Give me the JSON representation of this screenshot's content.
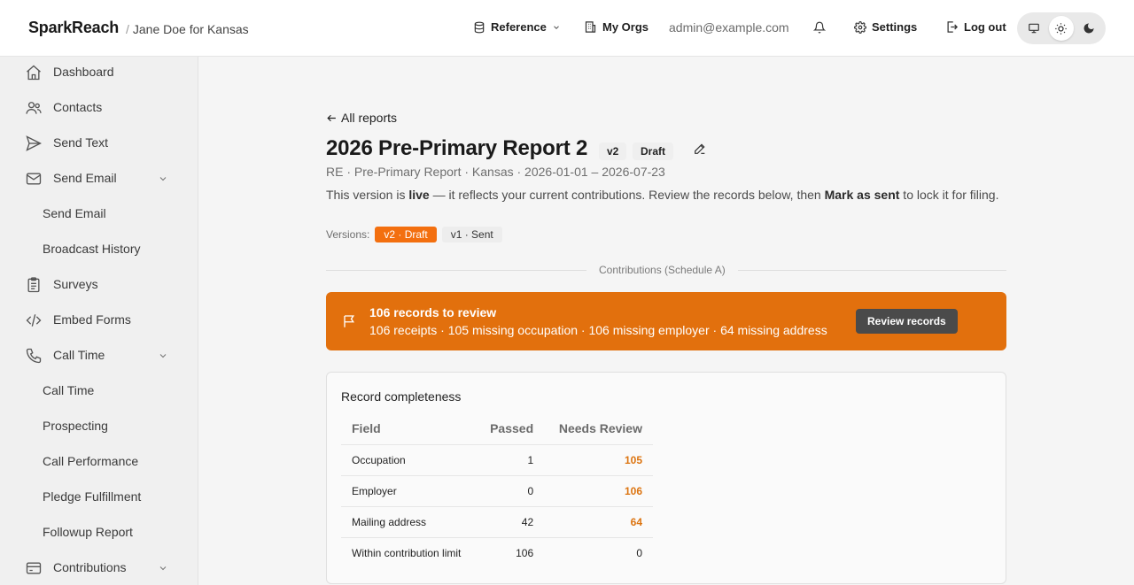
{
  "header": {
    "brand": "SparkReach",
    "org": "Jane Doe for Kansas",
    "reference_label": "Reference",
    "my_orgs_label": "My Orgs",
    "email": "admin@example.com",
    "settings_label": "Settings",
    "logout_label": "Log out"
  },
  "sidebar": {
    "items": [
      {
        "label": "Dashboard"
      },
      {
        "label": "Contacts"
      },
      {
        "label": "Send Text"
      },
      {
        "label": "Send Email"
      },
      {
        "label": "Send Email"
      },
      {
        "label": "Broadcast History"
      },
      {
        "label": "Surveys"
      },
      {
        "label": "Embed Forms"
      },
      {
        "label": "Call Time"
      },
      {
        "label": "Call Time"
      },
      {
        "label": "Prospecting"
      },
      {
        "label": "Call Performance"
      },
      {
        "label": "Pledge Fulfillment"
      },
      {
        "label": "Followup Report"
      },
      {
        "label": "Contributions"
      }
    ]
  },
  "report": {
    "back_label": "All reports",
    "title": "2026 Pre-Primary Report 2",
    "version_badge": "v2",
    "status_badge": "Draft",
    "meta": "RE · Pre-Primary Report · Kansas · 2026-01-01 – 2026-07-23",
    "desc_pre": "This version is ",
    "desc_live": "live",
    "desc_mid": " — it reflects your current contributions. Review the records below, then ",
    "desc_action": "Mark as sent",
    "desc_post": " to lock it for filing.",
    "versions_label": "Versions:",
    "versions": [
      "v2 · Draft",
      "v1 · Sent"
    ],
    "section_label": "Contributions (Schedule A)"
  },
  "alert": {
    "title": "106 records to review",
    "subtitle": "106 receipts · 105 missing occupation · 106 missing employer · 64 missing address",
    "button": "Review records"
  },
  "completeness": {
    "title": "Record completeness",
    "columns": [
      "Field",
      "Passed",
      "Needs Review"
    ],
    "rows": [
      {
        "field": "Occupation",
        "passed": "1",
        "needs": "105"
      },
      {
        "field": "Employer",
        "passed": "0",
        "needs": "106"
      },
      {
        "field": "Mailing address",
        "passed": "42",
        "needs": "64"
      },
      {
        "field": "Within contribution limit",
        "passed": "106",
        "needs": "0"
      }
    ]
  },
  "colors": {
    "accent": "#f36f0f",
    "alert_bg": "#e2700d",
    "warn_text": "#dc7410"
  }
}
